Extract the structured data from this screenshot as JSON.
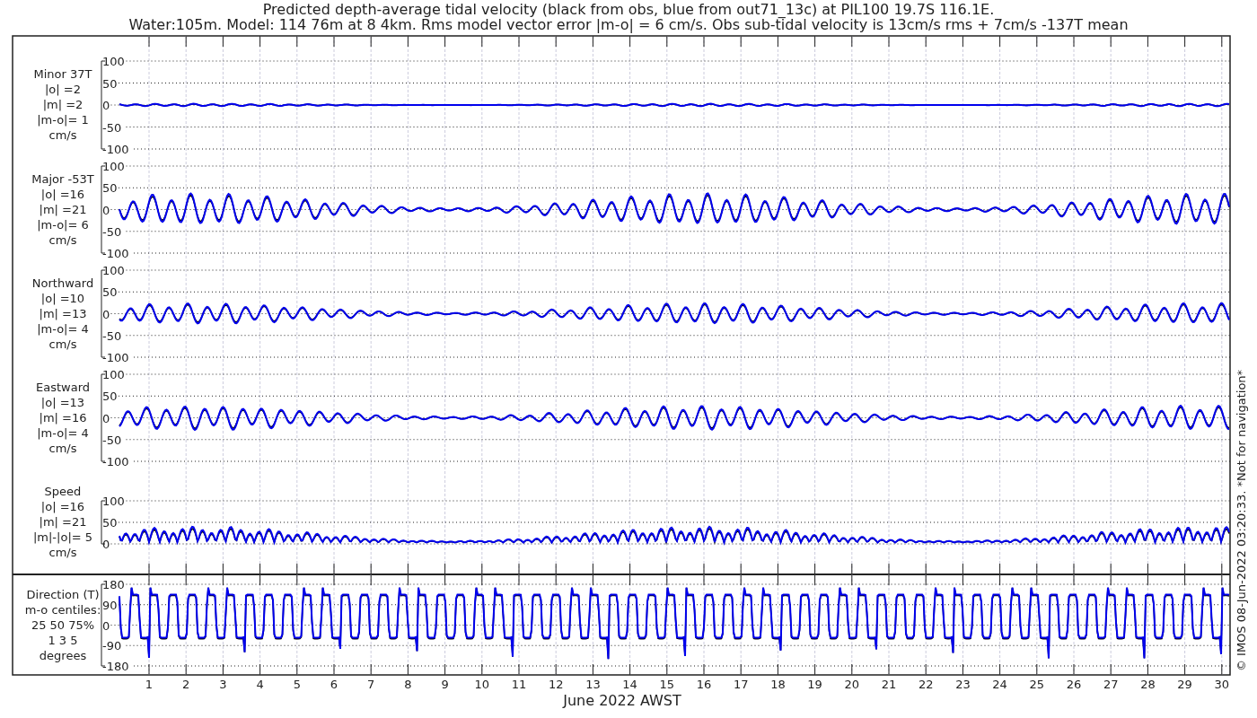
{
  "title_lines": [
    "Predicted depth-average tidal velocity (black from obs, blue from out71_13c) at PIL100 19.7S 116.1E.",
    "Water:105m. Model: 114 76m at 8 4km. Rms model vector error |m-o| = 6 cm/s. Obs sub-tidal velocity is 13cm/s rms + 7cm/s -137T mean"
  ],
  "panels": [
    {
      "kind": "signed",
      "label_lines": [
        "Minor 37T",
        "|o| =2",
        "|m| =2",
        "|m-o|= 1",
        "cm/s"
      ],
      "yticks": [
        "100",
        "50",
        "0",
        "-50",
        "-100"
      ]
    },
    {
      "kind": "signed",
      "label_lines": [
        "Major -53T",
        "|o| =16",
        "|m| =21",
        "|m-o|= 6",
        "cm/s"
      ],
      "yticks": [
        "100",
        "50",
        "0",
        "-50",
        "-100"
      ]
    },
    {
      "kind": "signed",
      "label_lines": [
        "Northward",
        "|o| =10",
        "|m| =13",
        "|m-o|= 4",
        "cm/s"
      ],
      "yticks": [
        "100",
        "50",
        "0",
        "-50",
        "-100"
      ]
    },
    {
      "kind": "signed",
      "label_lines": [
        "Eastward",
        "|o| =13",
        "|m| =16",
        "|m-o|= 4",
        "cm/s"
      ],
      "yticks": [
        "100",
        "50",
        "0",
        "-50",
        "-100"
      ]
    },
    {
      "kind": "speed",
      "label_lines": [
        "Speed",
        "|o| =16",
        "|m| =21",
        "|m|-|o|= 5",
        "cm/s"
      ],
      "yticks": [
        "100",
        "50",
        "0"
      ]
    },
    {
      "kind": "direction",
      "label_lines": [
        "Direction (T)",
        "m-o centiles:",
        "25  50  75%",
        "1  3  5",
        "degrees"
      ],
      "yticks": [
        "180",
        "90",
        "0",
        "-90",
        "-180"
      ]
    }
  ],
  "xticks": [
    "1",
    "2",
    "3",
    "4",
    "5",
    "6",
    "7",
    "8",
    "9",
    "10",
    "11",
    "12",
    "13",
    "14",
    "15",
    "16",
    "17",
    "18",
    "19",
    "20",
    "21",
    "22",
    "23",
    "24",
    "25",
    "26",
    "27",
    "28",
    "29",
    "30"
  ],
  "xlabel": "June 2022 AWST",
  "side_note": "© IMOS 08-Jun-2022 03:20:33. *Not for navigation*"
}
